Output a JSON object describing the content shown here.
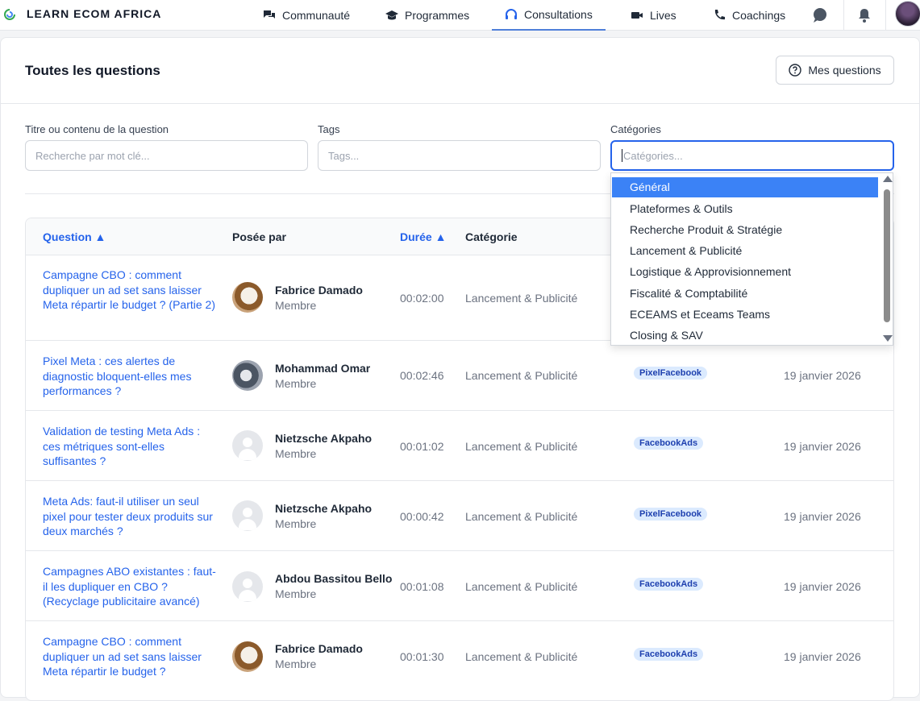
{
  "brand": "LEARN ECOM AFRICA",
  "nav": [
    {
      "label": "Communauté",
      "icon": "chat-bubbles-icon"
    },
    {
      "label": "Programmes",
      "icon": "graduation-cap-icon"
    },
    {
      "label": "Consultations",
      "icon": "headset-icon",
      "active": true
    },
    {
      "label": "Lives",
      "icon": "video-camera-icon"
    },
    {
      "label": "Coachings",
      "icon": "phone-icon"
    }
  ],
  "page": {
    "title": "Toutes les questions",
    "my_questions_label": "Mes questions"
  },
  "filters": {
    "question": {
      "label": "Titre ou contenu de la question",
      "placeholder": "Recherche par mot clé..."
    },
    "tags": {
      "label": "Tags",
      "placeholder": "Tags..."
    },
    "categories": {
      "label": "Catégories",
      "placeholder": "Catégories..."
    }
  },
  "dropdown": {
    "options": [
      "Général",
      "Plateformes & Outils",
      "Recherche Produit & Stratégie",
      "Lancement & Publicité",
      "Logistique & Approvisionnement",
      "Fiscalité & Comptabilité",
      "ECEAMS et Eceams Teams",
      "Closing & SAV"
    ],
    "selected": "Général"
  },
  "table": {
    "headers": {
      "question": "Question ▲",
      "asked_by": "Posée par",
      "duration": "Durée ▲",
      "category": "Catégorie"
    },
    "rows": [
      {
        "question": "Campagne CBO : comment dupliquer un ad set sans laisser Meta répartir le budget ? (Partie 2)",
        "name": "Fabrice Damado",
        "role": "Membre",
        "duration": "00:02:00",
        "category": "Lancement & Publicité",
        "tag": "",
        "date": ""
      },
      {
        "question": "Pixel Meta : ces alertes de diagnostic bloquent-elles mes performances ?",
        "name": "Mohammad Omar",
        "role": "Membre",
        "duration": "00:02:46",
        "category": "Lancement & Publicité",
        "tag": "PixelFacebook",
        "date": "19 janvier 2026"
      },
      {
        "question": "Validation de testing Meta Ads : ces métriques sont-elles suffisantes ?",
        "name": "Nietzsche Akpaho",
        "role": "Membre",
        "duration": "00:01:02",
        "category": "Lancement & Publicité",
        "tag": "FacebookAds",
        "date": "19 janvier 2026"
      },
      {
        "question": "Meta Ads: faut-il utiliser un seul pixel pour tester deux produits sur deux marchés ?",
        "name": "Nietzsche Akpaho",
        "role": "Membre",
        "duration": "00:00:42",
        "category": "Lancement & Publicité",
        "tag": "PixelFacebook",
        "date": "19 janvier 2026"
      },
      {
        "question": "Campagnes ABO existantes : faut-il les dupliquer en CBO ? (Recyclage publicitaire avancé)",
        "name": "Abdou Bassitou Bello",
        "role": "Membre",
        "duration": "00:01:08",
        "category": "Lancement & Publicité",
        "tag": "FacebookAds",
        "date": "19 janvier 2026"
      },
      {
        "question": "Campagne CBO : comment dupliquer un ad set sans laisser Meta répartir le budget ?",
        "name": "Fabrice Damado",
        "role": "Membre",
        "duration": "00:01:30",
        "category": "Lancement & Publicité",
        "tag": "FacebookAds",
        "date": "19 janvier 2026"
      }
    ]
  },
  "colors": {
    "accent": "#2563eb",
    "tag_bg": "#dbeafe",
    "selected_option": "#3b82f6"
  }
}
